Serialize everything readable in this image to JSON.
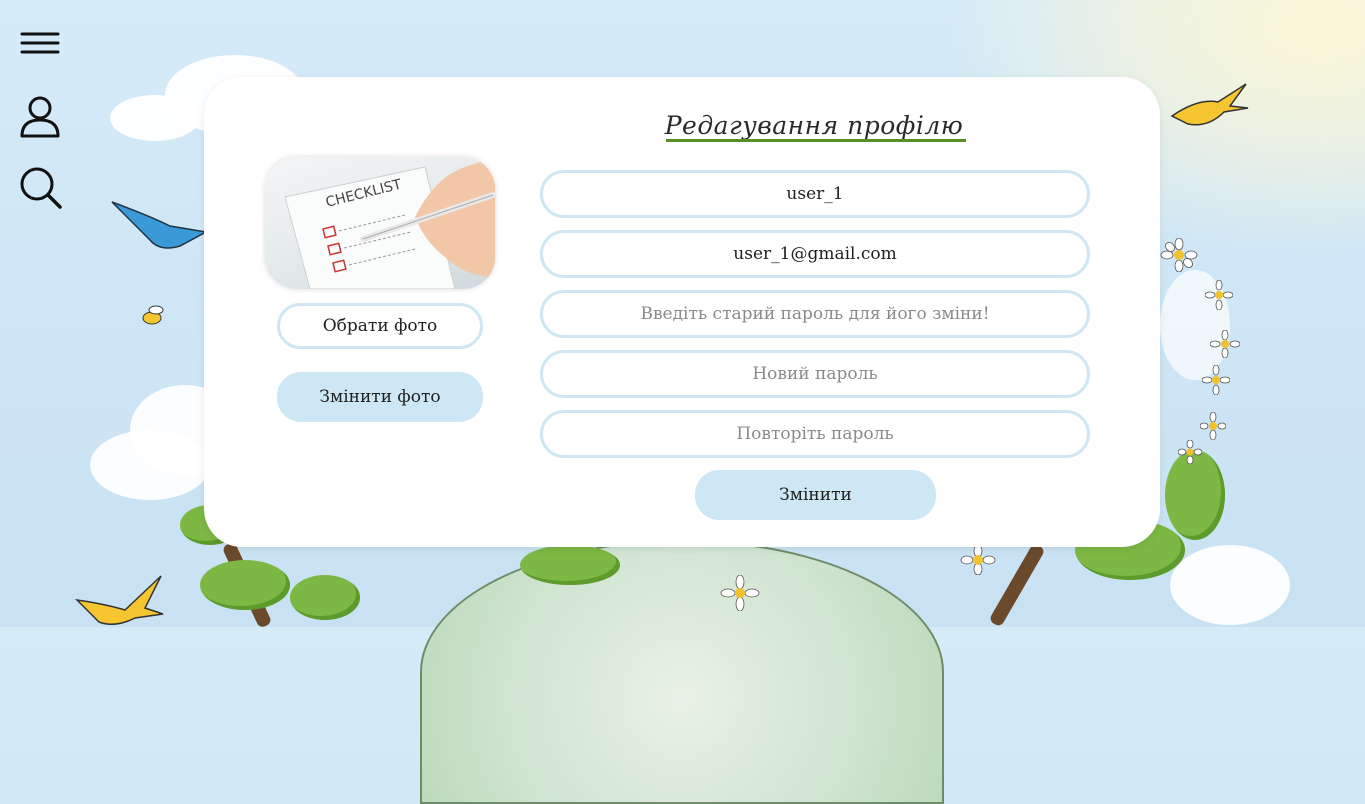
{
  "toolbar": {
    "menu_icon": "hamburger-menu-icon",
    "profile_icon": "user-icon",
    "search_icon": "search-icon"
  },
  "profile_form": {
    "title": "Редагування профілю",
    "photo_alt": "checklist-photo",
    "photo_text": "CHECKLIST",
    "choose_photo_label": "Обрати фото",
    "change_photo_label": "Змінити фото",
    "fields": {
      "username": {
        "value": "user_1"
      },
      "email": {
        "value": "user_1@gmail.com"
      },
      "old_password": {
        "placeholder": "Введіть старий пароль для його зміни!"
      },
      "new_password": {
        "placeholder": "Новий пароль"
      },
      "repeat_password": {
        "placeholder": "Повторіть пароль"
      }
    },
    "submit_label": "Змінити"
  },
  "colors": {
    "sky": "#d6ebf8",
    "button_fill": "#cde8f4",
    "field_border": "#cfe7f3",
    "title_underline": "#5b8c2a"
  }
}
